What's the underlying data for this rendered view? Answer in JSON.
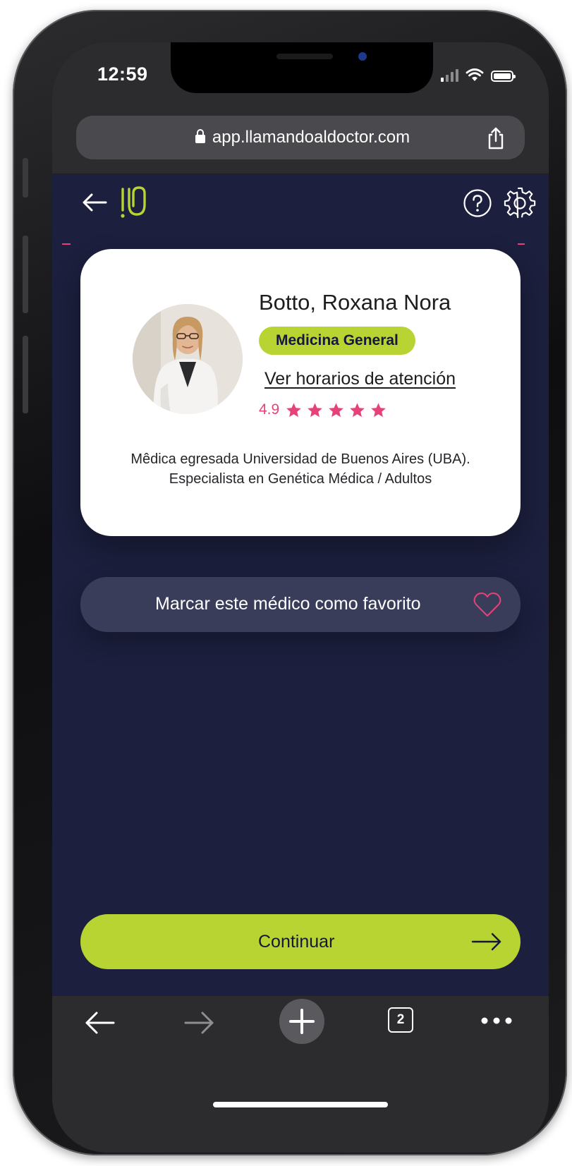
{
  "status_bar": {
    "time": "12:59"
  },
  "browser": {
    "url": "app.llamandoaldoctor.com",
    "open_tabs": "2",
    "icons": [
      "lock-icon",
      "share-icon",
      "back-arrow-icon",
      "forward-arrow-icon",
      "plus-icon",
      "tabs-icon",
      "more-icon"
    ]
  },
  "header": {
    "icons": [
      "back-arrow-icon",
      "logo",
      "help-icon",
      "gear-icon"
    ]
  },
  "doctor": {
    "name": "Botto, Roxana Nora",
    "specialty": "Medicina General",
    "schedule_link": "Ver horarios de atención",
    "rating": "4.9",
    "stars": 5,
    "bio_line1": "Mêdica egresada Universidad de Buenos Aires (UBA).",
    "bio_line2": "Especialista en Genética Médica / Adultos"
  },
  "favorite": {
    "label": "Marcar este médico como favorito",
    "icon": "heart-icon"
  },
  "continue_button": {
    "label": "Continuar",
    "icon": "arrow-right-icon"
  },
  "colors": {
    "background": "#1c1f3d",
    "accent_green": "#b8d432",
    "accent_pink": "#e6427a",
    "card": "#ffffff",
    "favorite_button": "#3a3d5a",
    "browser_chrome": "#2c2c2e"
  }
}
